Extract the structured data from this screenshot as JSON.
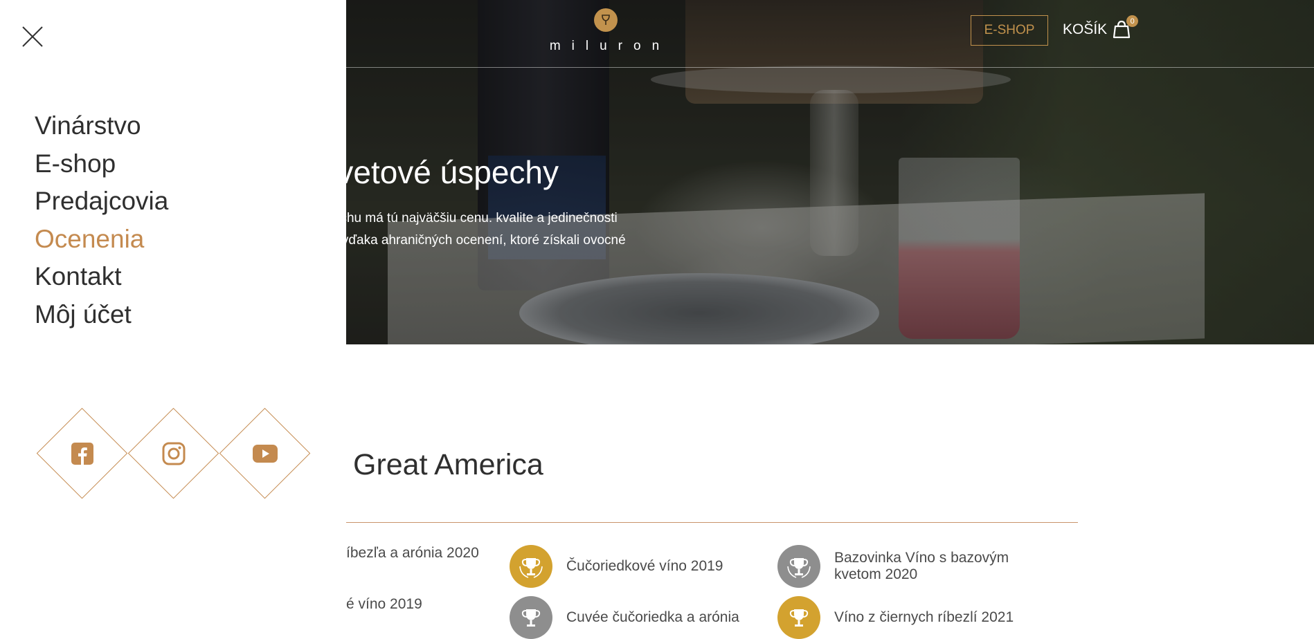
{
  "hero": {
    "title": "še svetové úspechy",
    "text": "osť z úspechu má tú najväčšiu cenu. kvalite a jedinečnosti našich vín vďaka ahraničných ocenení, ktoré získali ovocné"
  },
  "header": {
    "logo_text": "miluron",
    "logo_icon": "wine-glass-icon",
    "eshop_label": "E-SHOP",
    "cart_label": "KOŠÍK",
    "cart_count": "0",
    "cart_icon": "shopping-bag-icon"
  },
  "side_menu": {
    "close_icon": "close-icon",
    "items": [
      {
        "label": "Vinárstvo",
        "active": false
      },
      {
        "label": "E-shop",
        "active": false
      },
      {
        "label": "Predajcovia",
        "active": false
      },
      {
        "label": "Ocenenia",
        "active": true
      },
      {
        "label": "Kontakt",
        "active": false
      },
      {
        "label": "Môj účet",
        "active": false
      }
    ],
    "social": [
      {
        "name": "facebook-icon"
      },
      {
        "name": "instagram-icon"
      },
      {
        "name": "youtube-icon"
      }
    ]
  },
  "main": {
    "section_title": "Great America",
    "awards": [
      {
        "label": "íbezľa a arónia 2020",
        "medal": "none"
      },
      {
        "label": "Čučoriedkové víno 2019",
        "medal": "gold"
      },
      {
        "label": "Bazovinka Víno s bazovým kvetom 2020",
        "medal": "silver"
      },
      {
        "label": "é víno 2019",
        "medal": "none"
      },
      {
        "label": "Cuvée čučoriedka a arónia",
        "medal": "silver"
      },
      {
        "label": "Víno z čiernych ríbezlí 2021",
        "medal": "gold"
      }
    ]
  },
  "colors": {
    "accent": "#c48a4f",
    "gold_medal": "#d3a22f",
    "silver_medal": "#8e8e8e",
    "text_dark": "#2f2f2f"
  }
}
